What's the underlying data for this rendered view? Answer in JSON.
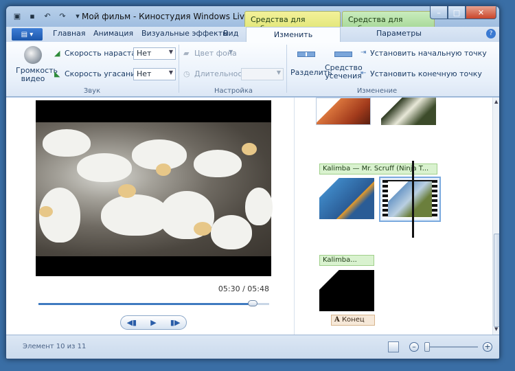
{
  "window": {
    "title": "Мой фильм - Киностудия Windows Live"
  },
  "context_tabs": {
    "video": "Средства для работы с видео",
    "music": "Средства для работы с муз..."
  },
  "tabs": [
    "Главная",
    "Анимация",
    "Визуальные эффекты",
    "Вид",
    "Изменить",
    "Параметры"
  ],
  "selected_tab": "Изменить",
  "ribbon": {
    "sound": {
      "volume_label": "Громкость видео",
      "fade_in_label": "Скорость нарастания:",
      "fade_in_value": "Нет",
      "fade_out_label": "Скорость угасания:",
      "fade_out_value": "Нет",
      "group": "Звук"
    },
    "settings": {
      "bg_color_label": "Цвет фона",
      "duration_label": "Длительность:",
      "group": "Настройка"
    },
    "edit": {
      "split_label": "Разделить",
      "trim_label": "Средство усечения",
      "set_start_label": "Установить начальную точку",
      "set_end_label": "Установить конечную точку",
      "group": "Изменение"
    }
  },
  "preview": {
    "time": "05:30 / 05:48",
    "progress": 0.93
  },
  "storyboard": {
    "caption1": "Kalimba — Mr. Scruff (Ninja T...",
    "caption2": "Kalimba...",
    "end_label": "Конец"
  },
  "status": {
    "text": "Элемент 10 из 11"
  },
  "zoom": {
    "level": 0.05
  },
  "colors": {
    "accent": "#3f7ac0",
    "context_video": "#e3e77b",
    "context_music": "#a9d99a"
  }
}
